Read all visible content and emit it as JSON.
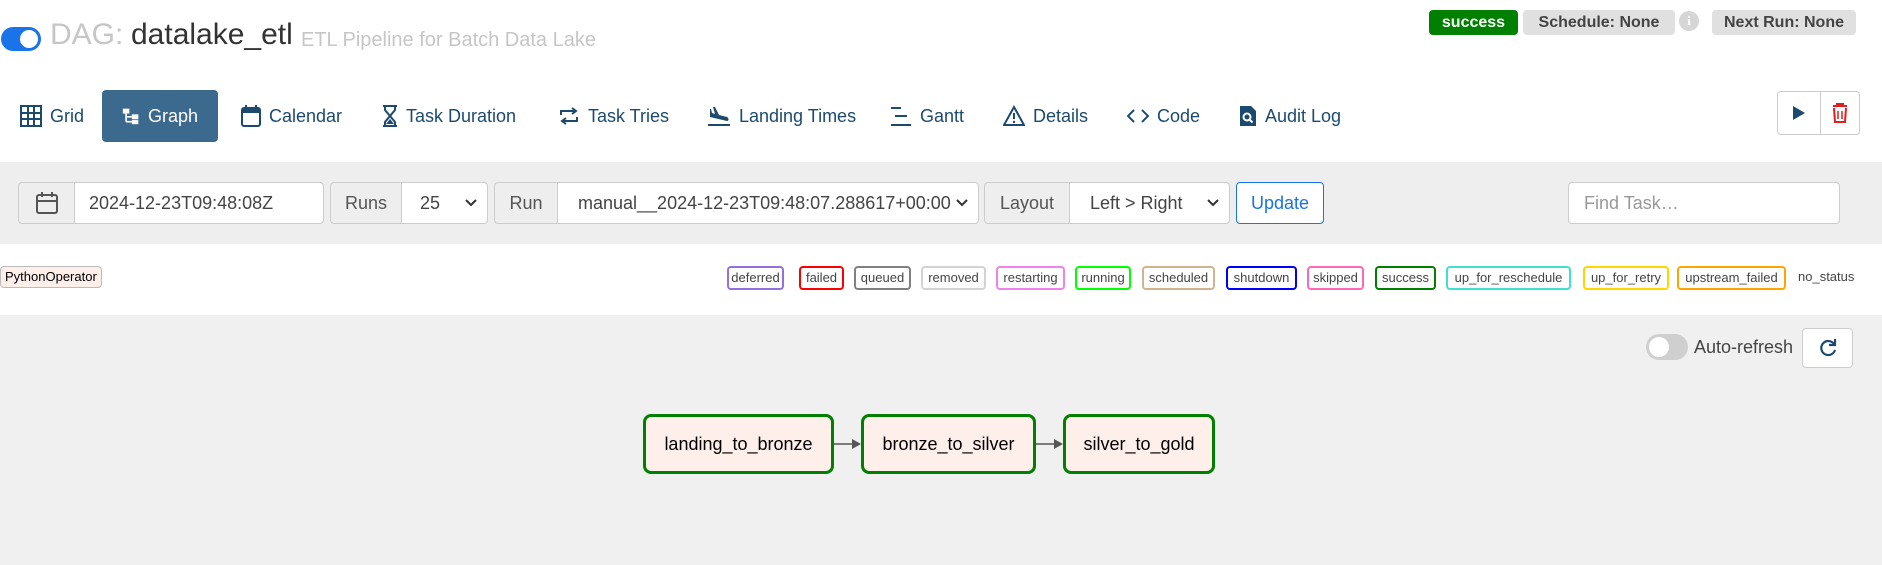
{
  "header": {
    "dag_prefix": "DAG:",
    "dag_id": "datalake_etl",
    "description": "ETL Pipeline for Batch Data Lake",
    "status_badge": "success",
    "schedule": "Schedule: None",
    "info_glyph": "i",
    "next_run": "Next Run: None",
    "paused_toggle_on": true
  },
  "tabs": [
    {
      "label": "Grid",
      "icon": "grid-icon"
    },
    {
      "label": "Graph",
      "icon": "graph-icon",
      "active": true
    },
    {
      "label": "Calendar",
      "icon": "calendar-icon"
    },
    {
      "label": "Task Duration",
      "icon": "hourglass-icon"
    },
    {
      "label": "Task Tries",
      "icon": "repeat-icon"
    },
    {
      "label": "Landing Times",
      "icon": "plane-landing-icon"
    },
    {
      "label": "Gantt",
      "icon": "gantt-icon"
    },
    {
      "label": "Details",
      "icon": "warning-triangle-icon"
    },
    {
      "label": "Code",
      "icon": "code-icon"
    },
    {
      "label": "Audit Log",
      "icon": "file-search-icon"
    }
  ],
  "filters": {
    "base_date": "2024-12-23T09:48:08Z",
    "runs_label": "Runs",
    "runs_value": "25",
    "run_label": "Run",
    "run_value": "manual__2024-12-23T09:48:07.288617+00:00",
    "layout_label": "Layout",
    "layout_value": "Left > Right",
    "update_label": "Update",
    "find_placeholder": "Find Task…"
  },
  "legend": {
    "operator": "PythonOperator",
    "operator_color": "#ffefeb",
    "states": [
      {
        "name": "deferred",
        "color": "#9370db"
      },
      {
        "name": "failed",
        "color": "#ff0000"
      },
      {
        "name": "queued",
        "color": "#808080"
      },
      {
        "name": "removed",
        "color": "#d3d3d3"
      },
      {
        "name": "restarting",
        "color": "#ee82ee"
      },
      {
        "name": "running",
        "color": "#00ff00"
      },
      {
        "name": "scheduled",
        "color": "#d2b48c"
      },
      {
        "name": "shutdown",
        "color": "#0000ff"
      },
      {
        "name": "skipped",
        "color": "#ff69b4"
      },
      {
        "name": "success",
        "color": "#008000"
      },
      {
        "name": "up_for_reschedule",
        "color": "#40e0d0"
      },
      {
        "name": "up_for_retry",
        "color": "#ffd700"
      },
      {
        "name": "upstream_failed",
        "color": "#ffa500"
      }
    ],
    "no_status": "no_status"
  },
  "graph": {
    "autorefresh_label": "Auto-refresh",
    "autorefresh_on": false,
    "tasks": [
      {
        "id": "landing_to_bronze",
        "state": "success"
      },
      {
        "id": "bronze_to_silver",
        "state": "success"
      },
      {
        "id": "silver_to_gold",
        "state": "success"
      }
    ],
    "edges": [
      [
        "landing_to_bronze",
        "bronze_to_silver"
      ],
      [
        "bronze_to_silver",
        "silver_to_gold"
      ]
    ]
  },
  "colors": {
    "accent": "#1a73e8",
    "active_tab": "#3c6a8f",
    "success": "#008000",
    "delete": "#e02020"
  }
}
